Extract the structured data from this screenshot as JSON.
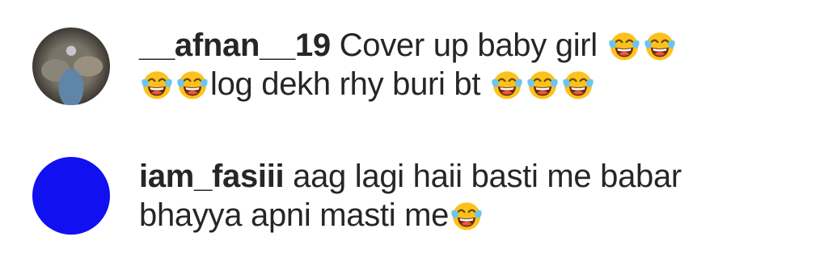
{
  "comments": [
    {
      "username": "__afnan__19",
      "segments": [
        {
          "type": "text",
          "value": " Cover up baby girl "
        },
        {
          "type": "emoji",
          "name": "face-with-tears-of-joy-icon"
        },
        {
          "type": "emoji",
          "name": "face-with-tears-of-joy-icon"
        },
        {
          "type": "break"
        },
        {
          "type": "emoji",
          "name": "face-with-tears-of-joy-icon"
        },
        {
          "type": "emoji",
          "name": "face-with-tears-of-joy-icon"
        },
        {
          "type": "text",
          "value": "log dekh rhy buri bt "
        },
        {
          "type": "emoji",
          "name": "face-with-tears-of-joy-icon"
        },
        {
          "type": "emoji",
          "name": "face-with-tears-of-joy-icon"
        },
        {
          "type": "emoji",
          "name": "face-with-tears-of-joy-icon"
        }
      ],
      "avatar": {
        "kind": "photo"
      }
    },
    {
      "username": "iam_fasiii",
      "segments": [
        {
          "type": "text",
          "value": " aag lagi haii basti me babar"
        },
        {
          "type": "break"
        },
        {
          "type": "text",
          "value": "bhayya apni masti me"
        },
        {
          "type": "emoji",
          "name": "face-with-tears-of-joy-icon"
        }
      ],
      "avatar": {
        "kind": "solid",
        "color": "#1010f0"
      }
    }
  ],
  "colors": {
    "text": "#262626",
    "emoji_face": "#fcc21b",
    "emoji_tear": "#6cc4f0"
  }
}
